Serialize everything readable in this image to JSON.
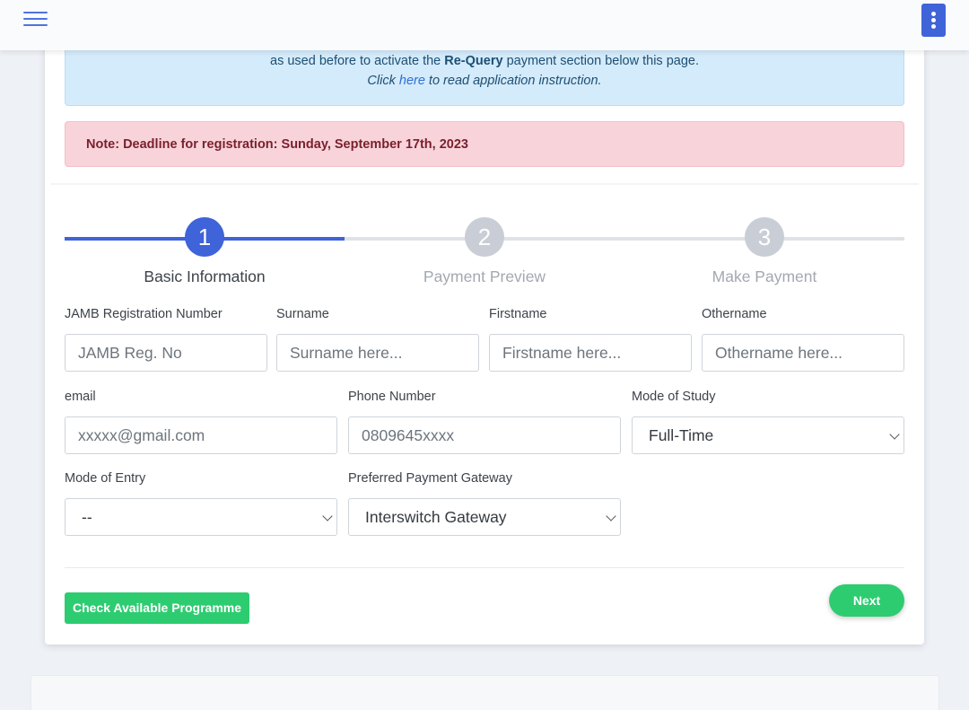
{
  "alerts": {
    "info_before": "as used before to activate the ",
    "info_bold": "Re-Query",
    "info_after": " payment section below this page.",
    "instruction_before": "Click ",
    "instruction_link": "here",
    "instruction_after": " to read application instruction.",
    "deadline": "Note: Deadline for registration: Sunday, September 17th, 2023"
  },
  "steps": [
    {
      "number": "1",
      "label": "Basic Information",
      "state": "active"
    },
    {
      "number": "2",
      "label": "Payment Preview",
      "state": "inactive"
    },
    {
      "number": "3",
      "label": "Make Payment",
      "state": "inactive"
    }
  ],
  "progress_fraction": 0.333,
  "form": {
    "jamb": {
      "label": "JAMB Registration Number",
      "placeholder": "JAMB Reg. No"
    },
    "surname": {
      "label": "Surname",
      "placeholder": "Surname here..."
    },
    "firstname": {
      "label": "Firstname",
      "placeholder": "Firstname here..."
    },
    "othername": {
      "label": "Othername",
      "placeholder": "Othername here..."
    },
    "email": {
      "label": "email",
      "placeholder": "xxxxx@gmail.com"
    },
    "phone": {
      "label": "Phone Number",
      "placeholder": "0809645xxxx"
    },
    "mode_of_study": {
      "label": "Mode of Study",
      "value": "Full-Time"
    },
    "mode_of_entry": {
      "label": "Mode of Entry",
      "value": "--"
    },
    "gateway": {
      "label": "Preferred Payment Gateway",
      "value": "Interswitch Gateway"
    }
  },
  "buttons": {
    "check_programme": "Check Available Programme",
    "next": "Next"
  },
  "colors": {
    "primary": "#3f63d8",
    "success": "#2ecc71",
    "info_bg": "#d4ebfb",
    "danger_bg": "#f8d4da",
    "step_inactive": "#c9ced6"
  },
  "icons": {
    "menu": "hamburger-menu-icon",
    "more": "vertical-dots-icon",
    "select": "chevron-down-icon"
  }
}
